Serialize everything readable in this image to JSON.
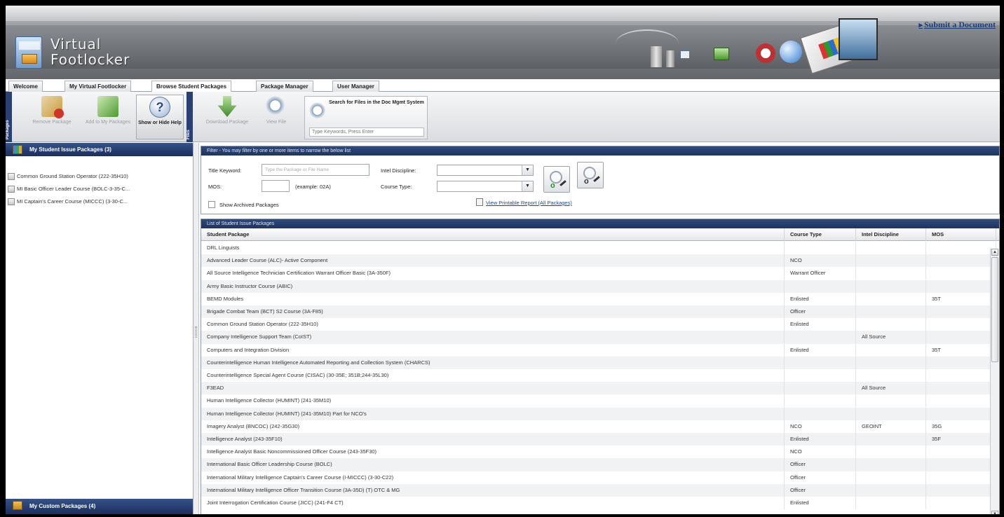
{
  "app": {
    "logo_line1": "Virtual",
    "logo_line2": "Footlocker",
    "submit_link": "Submit a Document"
  },
  "tabs": [
    {
      "label": "Welcome",
      "active": false
    },
    {
      "label": "My Virtual Footlocker",
      "active": false
    },
    {
      "label": "Browse Student Packages",
      "active": true
    },
    {
      "label": "Package Manager",
      "active": false
    },
    {
      "label": "User Manager",
      "active": false
    }
  ],
  "ribbon": {
    "group1_label": "Packages",
    "group2_label": "Files",
    "remove_package": "Remove Package",
    "add_to_my_packages": "Add to My Packages",
    "show_hide_help": "Show or Hide Help",
    "download_package": "Download Package",
    "view_file": "View File",
    "search_title": "Search for Files in the Doc Mgmt System",
    "search_placeholder": "Type Keywords, Press Enter"
  },
  "left_pane": {
    "issue_header": "My Student Issue Packages (3)",
    "issue_items": [
      "Common Ground Station Operator (222-35H10)",
      "MI Basic Officer Leader Course (BOLC-3-35-C...",
      "MI Captain's Career Course (MICCC) (3-30-C..."
    ],
    "custom_header": "My Custom Packages (4)"
  },
  "filter": {
    "header": "Filter - You may filter by one or more items to narrow the below list",
    "title_keyword_label": "Title Keyword:",
    "title_keyword_placeholder": "Type the Package or File Name",
    "mos_label": "MOS:",
    "mos_example": "(example: 02A)",
    "intel_discipline_label": "Intel Discipline:",
    "course_type_label": "Course Type:",
    "show_archived_label": "Show Archived Packages",
    "printable_report_link": "View Printable Report (All Packages)"
  },
  "grid": {
    "header": "List of Student Issue Packages",
    "columns": [
      "Student Package",
      "Course Type",
      "Intel Discipline",
      "MOS"
    ],
    "rows": [
      [
        "DRL Linguists",
        "",
        "",
        ""
      ],
      [
        "Advanced Leader Course (ALC)- Active Component",
        "NCO",
        "",
        ""
      ],
      [
        "All Source Intelligence Technician Certification Warrant Officer Basic (3A-350F)",
        "Warrant Officer",
        "",
        ""
      ],
      [
        "Army Basic Instructor Course (ABIC)",
        "",
        "",
        ""
      ],
      [
        "BEMD Modules",
        "Enlisted",
        "",
        "35T"
      ],
      [
        "Brigade Combat Team (BCT) S2 Course (3A-F85)",
        "Officer",
        "",
        ""
      ],
      [
        "Common Ground Station Operator (222-35H10)",
        "Enlisted",
        "",
        ""
      ],
      [
        "Company Intelligence Support Team (CoIST)",
        "",
        "All Source",
        ""
      ],
      [
        "Computers and Integration Division",
        "Enlisted",
        "",
        "35T"
      ],
      [
        "Counterintelligence Human Intelligence Automated Reporting and Collection System (CHARCS)",
        "",
        "",
        ""
      ],
      [
        "Counterintelligence Special Agent Course (CISAC) (30-35E; 351B;244-35L30)",
        "",
        "",
        ""
      ],
      [
        "F3EAD",
        "",
        "All Source",
        ""
      ],
      [
        "Human Intelligence Collector (HUMINT) (241-35M10)",
        "",
        "",
        ""
      ],
      [
        "Human Intelligence Collector (HUMINT) (241-35M10) Part for NCO's",
        "",
        "",
        ""
      ],
      [
        "Imagery Analyst (BNCOC) (242-35G30)",
        "NCO",
        "GEOINT",
        "35G"
      ],
      [
        "Intelligence Analyst (243-35F10)",
        "Enlisted",
        "",
        "35F"
      ],
      [
        "Intelligence Analyst Basic Noncommissioned Officer Course (243-35F30)",
        "NCO",
        "",
        ""
      ],
      [
        "International Basic Officer Leadership Course (BOLC)",
        "Officer",
        "",
        ""
      ],
      [
        "International Military Intelligence Captain's Career Course (I-MICCC) (3-30-C22)",
        "Officer",
        "",
        ""
      ],
      [
        "International Military Intelligence Officer Transition Course (3A-35D) (T) OTC & MG",
        "Officer",
        "",
        ""
      ],
      [
        "Joint Interrogation Certification Course (JICC) (241-F4 CT)",
        "Enlisted",
        "",
        ""
      ]
    ]
  },
  "colors": {
    "header_navy": "#1e3462",
    "link_blue": "#1f4a8a"
  }
}
